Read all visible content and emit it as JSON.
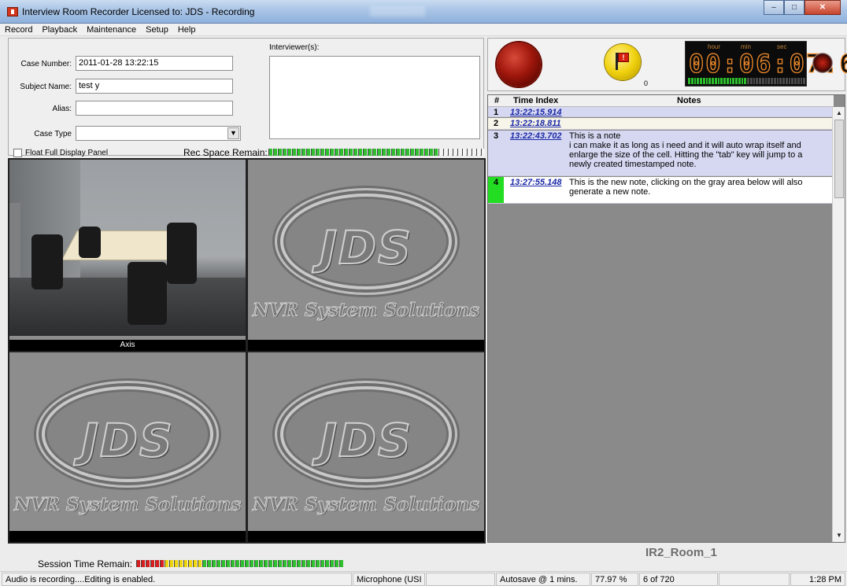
{
  "window": {
    "title": "Interview Room Recorder Licensed to: JDS - Recording"
  },
  "menu": [
    "Record",
    "Playback",
    "Maintenance",
    "Setup",
    "Help"
  ],
  "form": {
    "case_number_label": "Case Number:",
    "case_number_value": "2011-01-28 13:22:15",
    "subject_name_label": "Subject Name:",
    "subject_name_value": "test y",
    "alias_label": "Alias:",
    "alias_value": "",
    "case_type_label": "Case Type",
    "case_type_value": "",
    "interviewers_label": "Interviewer(s):",
    "interviewers_value": "",
    "float_panel_label": "Float Full Display Panel",
    "float_panel_checked": false,
    "rec_space_label": "Rec Space Remain:",
    "rec_space_level": 0.78
  },
  "video": {
    "tiles": [
      {
        "caption": "Axis",
        "type": "camera"
      },
      {
        "caption": "",
        "type": "logo",
        "logo_text": "JDS",
        "tagline": "NVR System Solutions"
      },
      {
        "caption": "",
        "type": "logo",
        "logo_text": "JDS",
        "tagline": "NVR System Solutions"
      },
      {
        "caption": "",
        "type": "logo",
        "logo_text": "JDS",
        "tagline": "NVR System Solutions"
      }
    ]
  },
  "controls": {
    "flag_count": "0",
    "clock": {
      "hour_label": "hour",
      "min_label": "min",
      "sec_label": "sec",
      "digits": "00:06:07.6"
    },
    "audio_level": 0.5
  },
  "notes": {
    "headers": {
      "num": "#",
      "time": "Time Index",
      "notes": "Notes"
    },
    "rows": [
      {
        "num": "1",
        "time": "13:22:15.914",
        "text": ""
      },
      {
        "num": "2",
        "time": "13:22:18.811",
        "text": ""
      },
      {
        "num": "3",
        "time": "13:22:43.702",
        "text": "This is a note\ni can make it as long as i need and it will auto wrap itself and enlarge the size of the cell.  Hitting the \"tab\" key will jump to a newly created timestamped note."
      },
      {
        "num": "4",
        "time": "13:27:55.148",
        "text": "This is the new note, clicking on the gray area below will also generate a new note."
      }
    ],
    "room_label": "IR2_Room_1"
  },
  "session": {
    "label": "Session Time Remain:",
    "level": 0.25
  },
  "status": {
    "message": "Audio is recording....Editing is enabled.",
    "mic": "Microphone (USI",
    "autosave": "Autosave @ 1 mins.",
    "percent": "77.97 %",
    "position": "6 of 720",
    "time": "1:28 PM"
  },
  "colors": {
    "timestamp": "#1a29a6",
    "clock_digits": "#f08b2a",
    "active_row_marker": "#22dd22",
    "room_label": "#6d6d6d"
  }
}
